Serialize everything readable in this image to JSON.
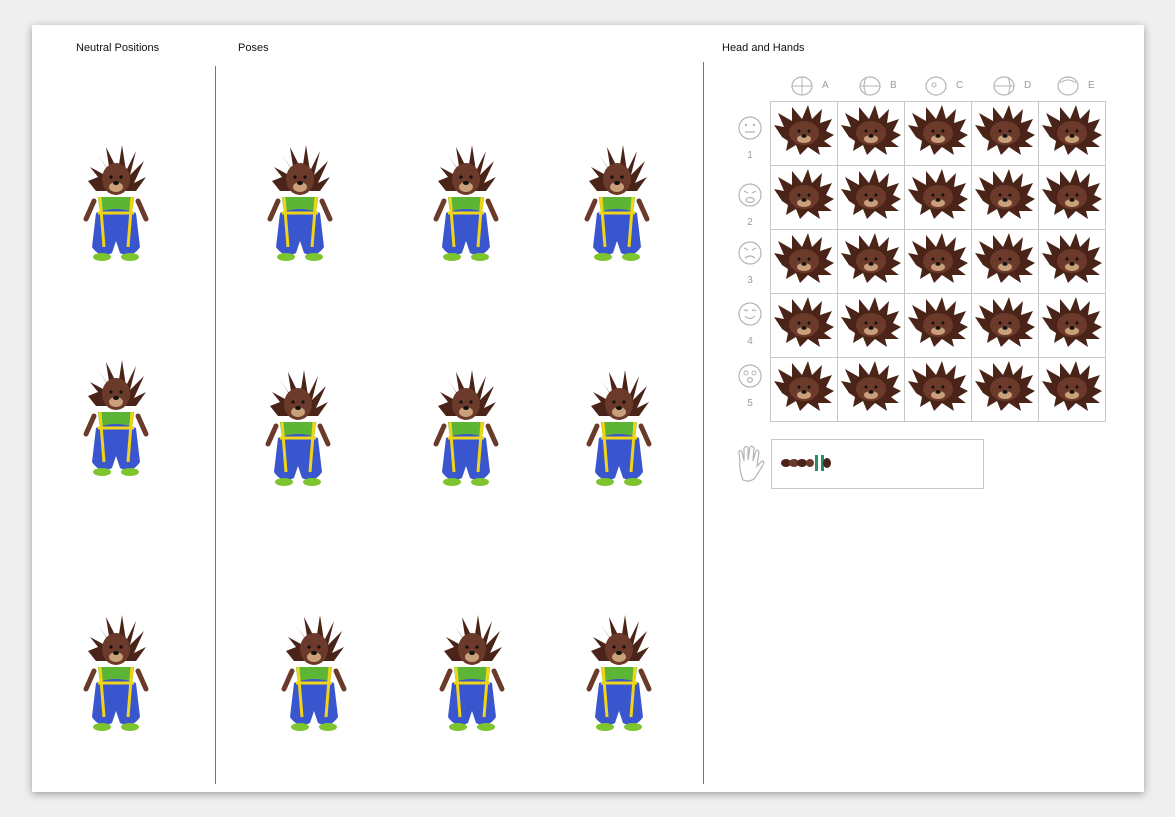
{
  "sections": {
    "neutral_title": "Neutral Positions",
    "poses_title": "Poses",
    "head_hands_title": "Head and Hands"
  },
  "grid": {
    "columns": [
      "A",
      "B",
      "C",
      "D",
      "E"
    ],
    "rows": [
      "1",
      "2",
      "3",
      "4",
      "5"
    ],
    "expressions": [
      "neutral-face-icon",
      "cry-face-icon",
      "angry-face-icon",
      "smile-face-icon",
      "surprised-face-icon"
    ]
  },
  "hands": {
    "icon": "hand-icon"
  },
  "colors": {
    "fur": "#6b3a2a",
    "quill": "#4a2418",
    "shirt": "#5db536",
    "overalls": "#3a56cf",
    "straps": "#f0d418",
    "shoes": "#7dc42e",
    "outline": "#b4b4b4"
  }
}
